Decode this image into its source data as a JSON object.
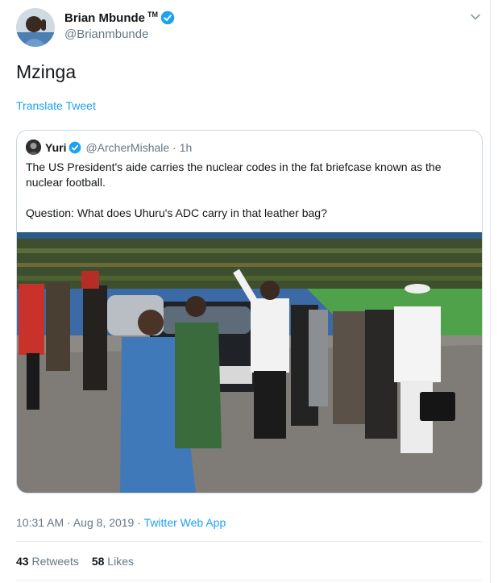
{
  "tweet": {
    "author_name": "Brian Mbunde",
    "author_badge": "TM",
    "author_handle": "@Brianmbunde",
    "text": "Mzinga",
    "translate_label": "Translate Tweet",
    "time": "10:31 AM",
    "date": "Aug 8, 2019",
    "source": "Twitter Web App",
    "meta_sep": " · ",
    "retweets_count": "43",
    "retweets_label": "Retweets",
    "likes_count": "58",
    "likes_label": "Likes"
  },
  "quoted": {
    "author_name": "Yuri",
    "author_handle": "@ArcherMishale",
    "age": "· 1h",
    "text_1": "The US President's aide carries the nuclear codes in the fat briefcase known as the nuclear football.",
    "text_2": "Question: What does Uhuru's ADC carry in that leather bag?"
  },
  "colors": {
    "accent": "#1da1f2",
    "secondary_text": "#657786",
    "primary_text": "#14171a",
    "border": "#ccd6dd"
  },
  "icons": [
    "verified-badge-icon",
    "chevron-down-icon"
  ]
}
